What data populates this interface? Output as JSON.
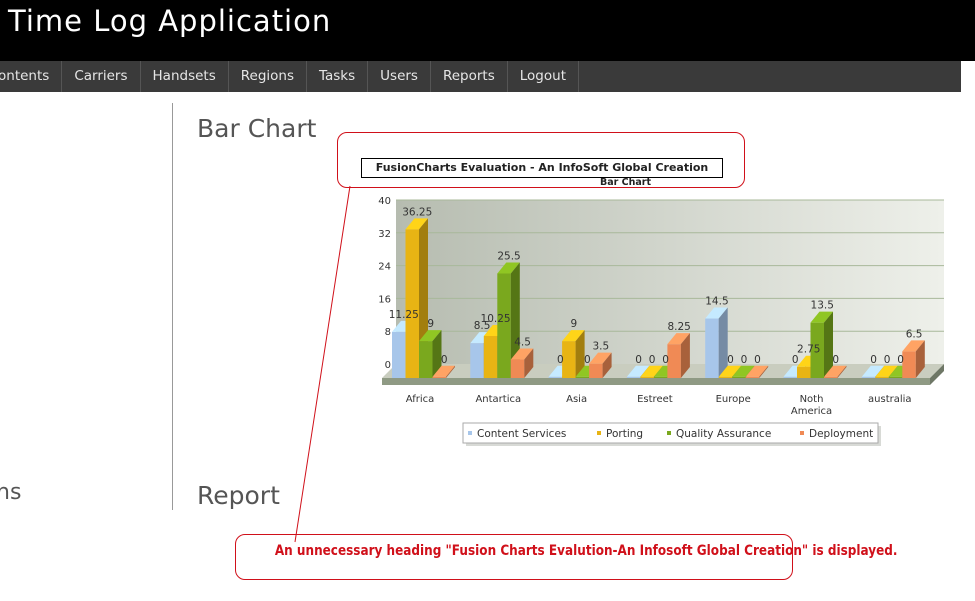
{
  "app_title": "Time Log Application",
  "nav": [
    "ontents",
    "Carriers",
    "Handsets",
    "Regions",
    "Tasks",
    "Users",
    "Reports",
    "Logout"
  ],
  "sidebar_text": "ns",
  "sections": {
    "bar_chart": "Bar Chart",
    "report": "Report"
  },
  "annotation": "An unnecessary heading \"Fusion Charts Evalution-An Infosoft Global Creation\" is displayed.",
  "colors": {
    "accent_red": "#d0101a",
    "header_bg": "#000000",
    "nav_bg": "#3a3a3a"
  },
  "chart_data": {
    "type": "bar",
    "title": "FusionCharts Evaluation - An InfoSoft Global Creation",
    "subtitle": "Bar Chart",
    "categories": [
      "Africa",
      "Antartica",
      "Asia",
      "Estreet",
      "Europe",
      "Noth America",
      "australia"
    ],
    "series": [
      {
        "name": "Content Services",
        "values": [
          11.25,
          8.5,
          0,
          0,
          14.5,
          0,
          0
        ],
        "color": "#a7c6ea"
      },
      {
        "name": "Porting",
        "values": [
          36.25,
          10.25,
          9,
          0,
          0,
          2.75,
          0
        ],
        "color": "#e8b414"
      },
      {
        "name": "Quality Assurance",
        "values": [
          9,
          25.5,
          0,
          0,
          0,
          13.5,
          0
        ],
        "color": "#7aa81e"
      },
      {
        "name": "Deployment",
        "values": [
          0,
          4.5,
          3.5,
          8.25,
          0,
          0,
          6.5
        ],
        "color": "#f08a55"
      }
    ],
    "ylim": [
      0,
      40
    ],
    "yticks": [
      0,
      8,
      16,
      24,
      32,
      40
    ],
    "legend_position": "bottom"
  }
}
